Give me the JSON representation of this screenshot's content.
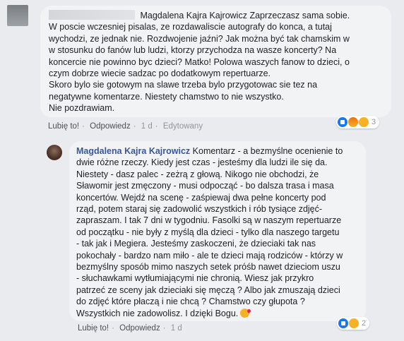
{
  "comment1": {
    "author": "Magdalena Kajra Kajrowicz",
    "lines": [
      "Zaprzeczasz sama sobie.",
      "W poscie wczesniej pisalas, ze rozdawaliscie autografy do konca, a tutaj",
      "wychodzi, ze jednak nie. Rozdwojenie jaźni? Jak można być tak chamskim w",
      "w stosunku do fanów lub ludzi, ktorzy przychodza na wasze koncerty? Na",
      "koncercie nie powinno byc dzieci? Matko! Polowa waszych fanow to dzieci, o",
      "czym dobrze wiecie sadzac po dodatkowym repertuarze.",
      "Skoro bylo sie gotowym na slawe trzeba bylo przygotowac sie tez na",
      "negatywne komentarze. Niestety chamstwo to nie wszystko.",
      "Nie pozdrawiam."
    ],
    "actions": {
      "like": "Lubię to!",
      "reply": "Odpowiedz",
      "time": "1 d",
      "edited": "Edytowany"
    },
    "reactions": {
      "icons": [
        "like-icon",
        "angry-icon",
        "laugh-icon"
      ],
      "count": "3"
    }
  },
  "comment2": {
    "author": "Magdalena Kajra Kajrowicz",
    "lines": [
      "Komentarz - a bezmyślne ocenienie to",
      "dwie różne rzeczy. Kiedy jest czas - jesteśmy dla ludzi ile się da.",
      "Niestety - dasz palec - zeżrą z głową. Nikogo nie obchodzi, że",
      "Sławomir jest zmęczony - musi odpocząć - bo dalsza trasa i masa",
      "koncertów. Wejdź na scenę - zaśpiewaj dwa pełne koncerty pod",
      "rząd, potem staraj się zadowolić wszystkich i rób tysiące zdjęć-",
      "zapraszam. I tak 7 dni w tygodniu. Fasolki są w naszym repertuarze",
      "od początku - nie były z myślą dla dzieci - tylko dla naszego targetu",
      "- tak jak i Megiera. Jesteśmy zaskoczeni, że dzieciaki tak nas",
      "pokochały - bardzo nam miło - ale te dzieci mają rodziców - którzy w",
      "bezmyślny sposób mimo naszych setek próśb nawet dzieciom uszu",
      "- słuchawkami wytłumiającymi nie chronią. Wiesz jak przykro",
      "patrzeć ze sceny jak dzieciaki się męczą ? Albo jak zmuszają dzieci",
      "do zdjęć które płaczą i nie chcą ? Chamstwo czy głupota ?",
      "Wszystkich nie zadowolisz. I dzięki Bogu."
    ],
    "emoji": "kiss-emoji-icon",
    "actions": {
      "like": "Lubię to!",
      "reply": "Odpowiedz",
      "time": "1 d"
    },
    "reactions": {
      "icons": [
        "like-icon",
        "laugh-icon"
      ],
      "count": "2"
    }
  }
}
